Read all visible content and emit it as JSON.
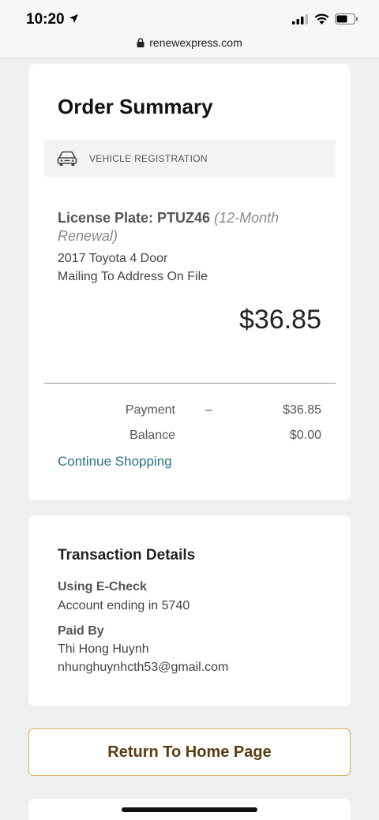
{
  "status_bar": {
    "time": "10:20"
  },
  "browser": {
    "url": "renewexpress.com"
  },
  "order_summary": {
    "title": "Order Summary",
    "category_label": "VEHICLE REGISTRATION",
    "plate_label": "License Plate: PTUZ46",
    "plate_note": "(12-Month Renewal)",
    "vehicle": "2017 Toyota 4 Door",
    "mailing": "Mailing To Address On File",
    "price": "$36.85",
    "payment_label": "Payment",
    "payment_dash": "–",
    "payment_value": "$36.85",
    "balance_label": "Balance",
    "balance_value": "$0.00",
    "continue_label": "Continue Shopping"
  },
  "transaction": {
    "title": "Transaction Details",
    "method_heading": "Using E-Check",
    "account_text": "Account ending in 5740",
    "paid_by_heading": "Paid By",
    "payer_name": "Thi Hong Huynh",
    "payer_email": "nhunghuynhcth53@gmail.com"
  },
  "actions": {
    "home_label": "Return To Home Page"
  },
  "colors": {
    "link": "#2a6f8a",
    "button_border": "#d8b15e",
    "button_text": "#5a3d0f"
  }
}
